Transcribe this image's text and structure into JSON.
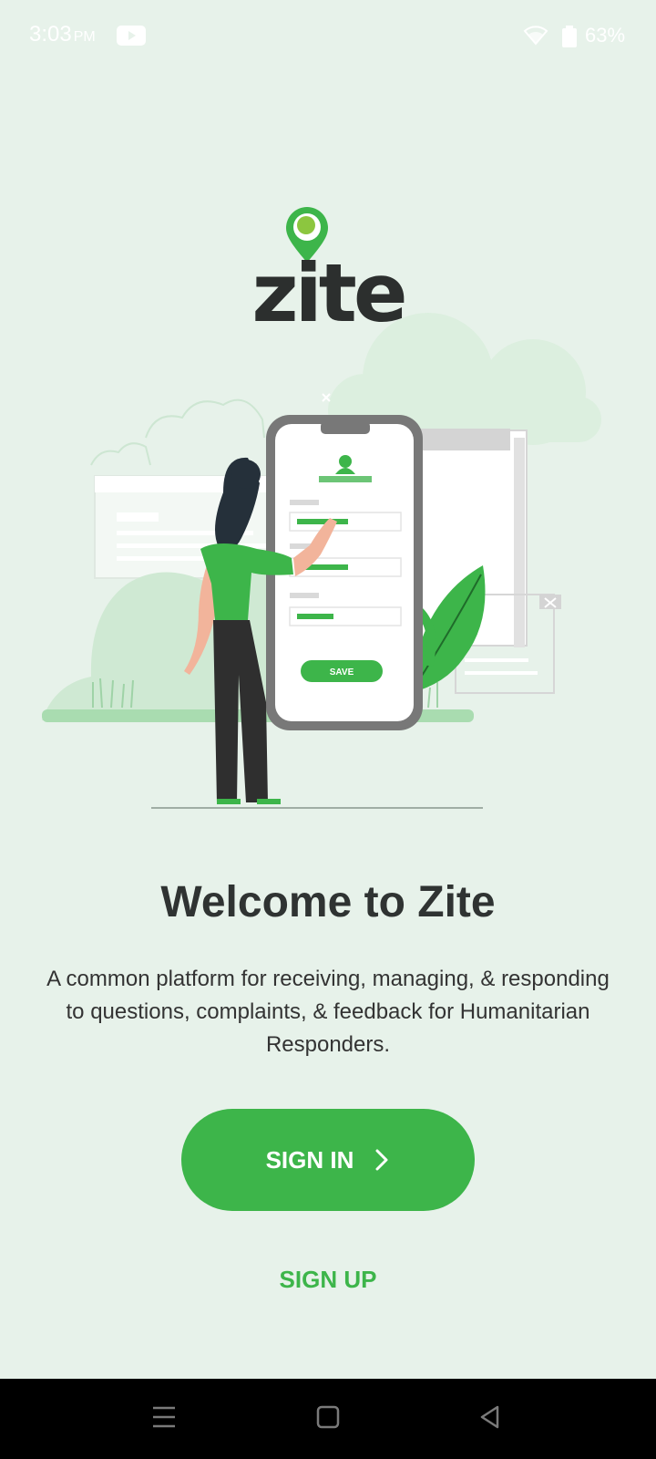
{
  "status_bar": {
    "time": "3:03",
    "ampm": "PM",
    "battery": "63%",
    "icons": [
      "youtube-icon",
      "wifi-icon",
      "battery-icon"
    ]
  },
  "logo": {
    "wordmark": "zite",
    "pin_color": "#3db54a"
  },
  "illustration": {
    "save_button_label": "SAVE"
  },
  "welcome": {
    "title": "Welcome to Zite",
    "description": "A common platform for receiving, managing, & responding to questions, complaints, & feedback for Humanitarian Responders."
  },
  "actions": {
    "sign_in_label": "SIGN IN",
    "sign_up_label": "SIGN UP"
  },
  "nav_bar": {
    "icons": [
      "menu-icon",
      "home-icon",
      "back-icon"
    ]
  },
  "colors": {
    "accent": "#3db54a",
    "background": "#e7f2ea",
    "text_dark": "#2f3332"
  }
}
